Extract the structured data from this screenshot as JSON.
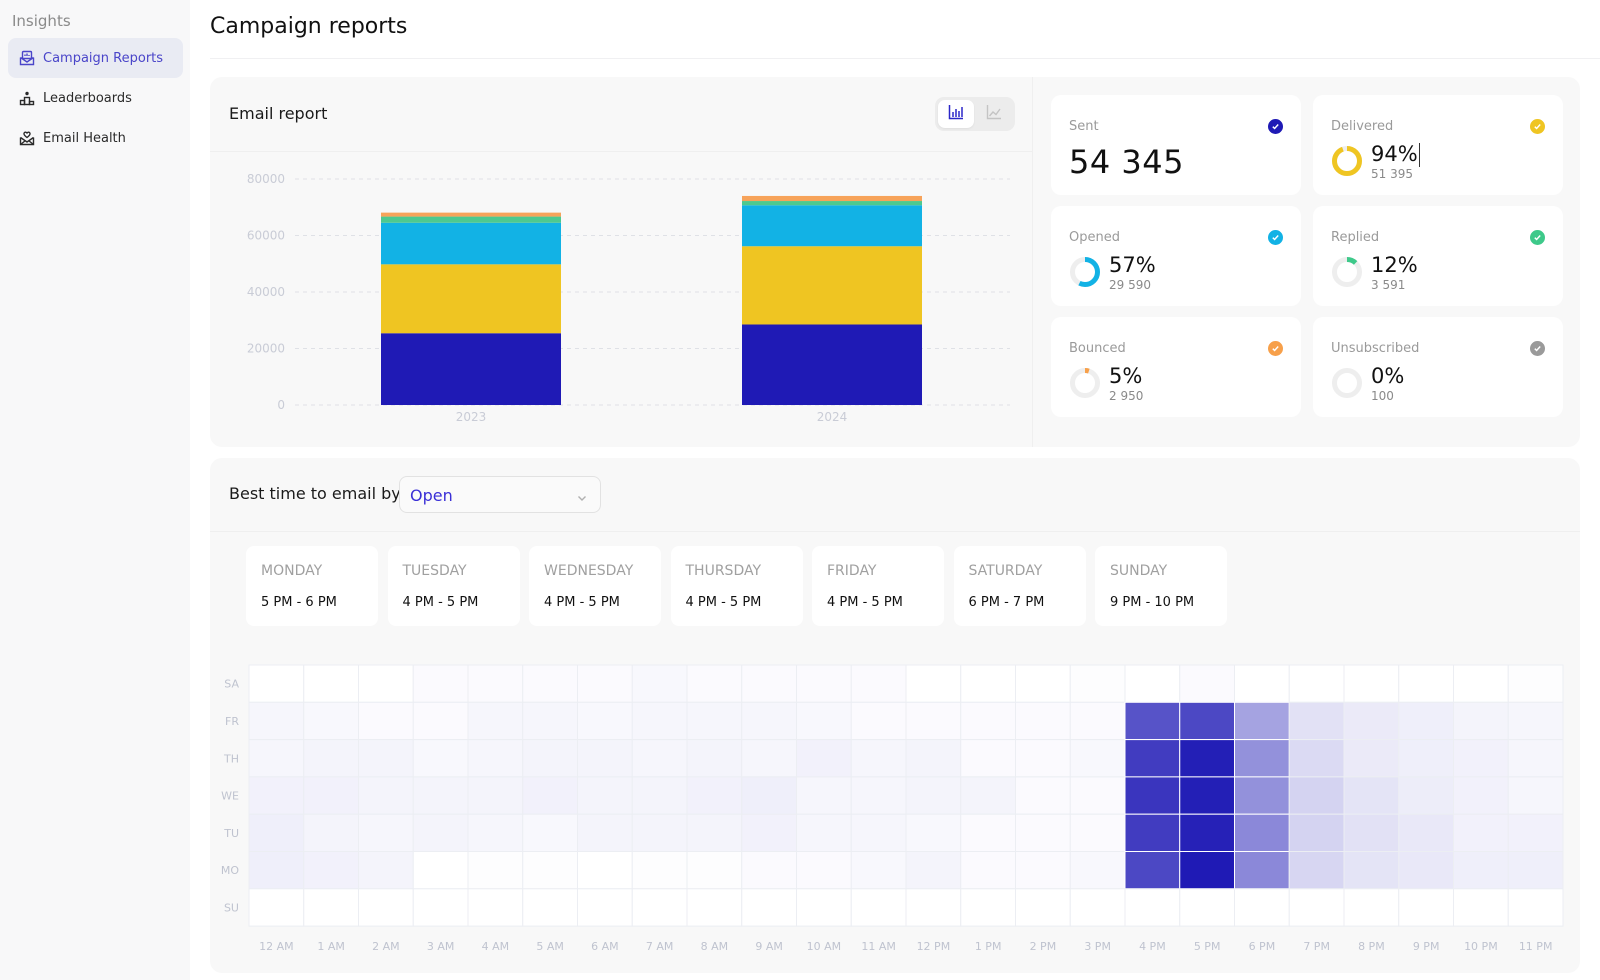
{
  "sidebar": {
    "section_label": "Insights",
    "items": [
      {
        "label": "Campaign Reports",
        "icon": "envelope-chart-icon",
        "active": true
      },
      {
        "label": "Leaderboards",
        "icon": "podium-icon",
        "active": false
      },
      {
        "label": "Email Health",
        "icon": "envelope-heart-icon",
        "active": false
      }
    ]
  },
  "header": {
    "title": "Campaign reports"
  },
  "email_report": {
    "title": "Email report",
    "view_toggle": [
      {
        "icon": "bar-chart-icon",
        "selected": true
      },
      {
        "icon": "line-chart-icon",
        "selected": false
      }
    ]
  },
  "stats": {
    "sent": {
      "label": "Sent",
      "value": "54 345",
      "color": "#1f1ab5"
    },
    "delivered": {
      "label": "Delivered",
      "percent": "94%",
      "count": "51 395",
      "fraction": 0.94,
      "color": "#efc522"
    },
    "opened": {
      "label": "Opened",
      "percent": "57%",
      "count": "29 590",
      "fraction": 0.57,
      "color": "#12b2e5"
    },
    "replied": {
      "label": "Replied",
      "percent": "12%",
      "count": "3 591",
      "fraction": 0.12,
      "color": "#3ec98a"
    },
    "bounced": {
      "label": "Bounced",
      "percent": "5%",
      "count": "2 950",
      "fraction": 0.05,
      "color": "#f7a04a"
    },
    "unsubscribed": {
      "label": "Unsubscribed",
      "percent": "0%",
      "count": "100",
      "fraction": 0.0,
      "color": "#9a9a9a"
    }
  },
  "best_time": {
    "label": "Best time to email by",
    "select_value": "Open",
    "days": [
      {
        "name": "MONDAY",
        "time": "5 PM - 6 PM"
      },
      {
        "name": "TUESDAY",
        "time": "4 PM - 5 PM"
      },
      {
        "name": "WEDNESDAY",
        "time": "4 PM - 5 PM"
      },
      {
        "name": "THURSDAY",
        "time": "4 PM - 5 PM"
      },
      {
        "name": "FRIDAY",
        "time": "4 PM - 5 PM"
      },
      {
        "name": "SATURDAY",
        "time": "6 PM - 7 PM"
      },
      {
        "name": "SUNDAY",
        "time": "9 PM - 10 PM"
      }
    ]
  },
  "chart_data": [
    {
      "type": "bar",
      "stacked": true,
      "title": "Email report",
      "categories": [
        "2023",
        "2024"
      ],
      "series": [
        {
          "name": "Sent",
          "color": "#1f1ab5",
          "values": [
            25400,
            28500
          ]
        },
        {
          "name": "Delivered",
          "color": "#efc522",
          "values": [
            24400,
            27700
          ]
        },
        {
          "name": "Opened",
          "color": "#12b2e5",
          "values": [
            14700,
            14500
          ]
        },
        {
          "name": "Replied",
          "color": "#4ec98f",
          "values": [
            2200,
            1500
          ]
        },
        {
          "name": "Bounced",
          "color": "#f7a35a",
          "values": [
            1400,
            1800
          ]
        }
      ],
      "yticks": [
        0,
        20000,
        40000,
        60000,
        80000
      ],
      "ylim": [
        0,
        80000
      ],
      "grid": true,
      "xlabel": "",
      "ylabel": ""
    },
    {
      "type": "heatmap",
      "title": "Best time to email by Open",
      "x": [
        "12 AM",
        "1 AM",
        "2 AM",
        "3 AM",
        "4 AM",
        "5 AM",
        "6 AM",
        "7 AM",
        "8 AM",
        "9 AM",
        "10 AM",
        "11 AM",
        "12 PM",
        "1 PM",
        "2 PM",
        "3 PM",
        "4 PM",
        "5 PM",
        "6 PM",
        "7 PM",
        "8 PM",
        "9 PM",
        "10 PM",
        "11 PM"
      ],
      "y": [
        "SA",
        "FR",
        "TH",
        "WE",
        "TU",
        "MO",
        "SU"
      ],
      "color_scale": [
        "#ffffff",
        "#1f1ab5"
      ],
      "values": [
        [
          0.0,
          0.0,
          0.0,
          0.02,
          0.02,
          0.02,
          0.02,
          0.03,
          0.02,
          0.02,
          0.02,
          0.02,
          0.0,
          0.0,
          0.0,
          0.01,
          0.0,
          0.02,
          0.0,
          0.0,
          0.0,
          0.0,
          0.0,
          0.01
        ],
        [
          0.04,
          0.03,
          0.02,
          0.02,
          0.04,
          0.04,
          0.03,
          0.04,
          0.04,
          0.04,
          0.03,
          0.02,
          0.02,
          0.02,
          0.02,
          0.02,
          0.75,
          0.8,
          0.4,
          0.13,
          0.09,
          0.07,
          0.05,
          0.04
        ],
        [
          0.04,
          0.05,
          0.05,
          0.03,
          0.04,
          0.05,
          0.05,
          0.04,
          0.05,
          0.04,
          0.06,
          0.04,
          0.05,
          0.02,
          0.02,
          0.03,
          0.85,
          0.98,
          0.48,
          0.16,
          0.09,
          0.07,
          0.06,
          0.04
        ],
        [
          0.06,
          0.06,
          0.05,
          0.05,
          0.05,
          0.06,
          0.05,
          0.05,
          0.06,
          0.07,
          0.04,
          0.04,
          0.05,
          0.05,
          0.02,
          0.02,
          0.88,
          0.98,
          0.48,
          0.19,
          0.12,
          0.08,
          0.06,
          0.04
        ],
        [
          0.07,
          0.05,
          0.04,
          0.05,
          0.04,
          0.03,
          0.05,
          0.05,
          0.05,
          0.06,
          0.04,
          0.04,
          0.03,
          0.02,
          0.02,
          0.02,
          0.85,
          0.97,
          0.52,
          0.19,
          0.13,
          0.1,
          0.06,
          0.06
        ],
        [
          0.07,
          0.06,
          0.05,
          0.0,
          0.01,
          0.01,
          0.0,
          0.01,
          0.01,
          0.02,
          0.02,
          0.03,
          0.05,
          0.02,
          0.02,
          0.03,
          0.8,
          1.0,
          0.52,
          0.18,
          0.12,
          0.1,
          0.07,
          0.07
        ],
        [
          0.0,
          0.0,
          0.0,
          0.0,
          0.0,
          0.0,
          0.0,
          0.0,
          0.0,
          0.0,
          0.0,
          0.0,
          0.0,
          0.0,
          0.0,
          0.0,
          0.0,
          0.0,
          0.0,
          0.0,
          0.0,
          0.0,
          0.0,
          0.0
        ]
      ]
    }
  ]
}
